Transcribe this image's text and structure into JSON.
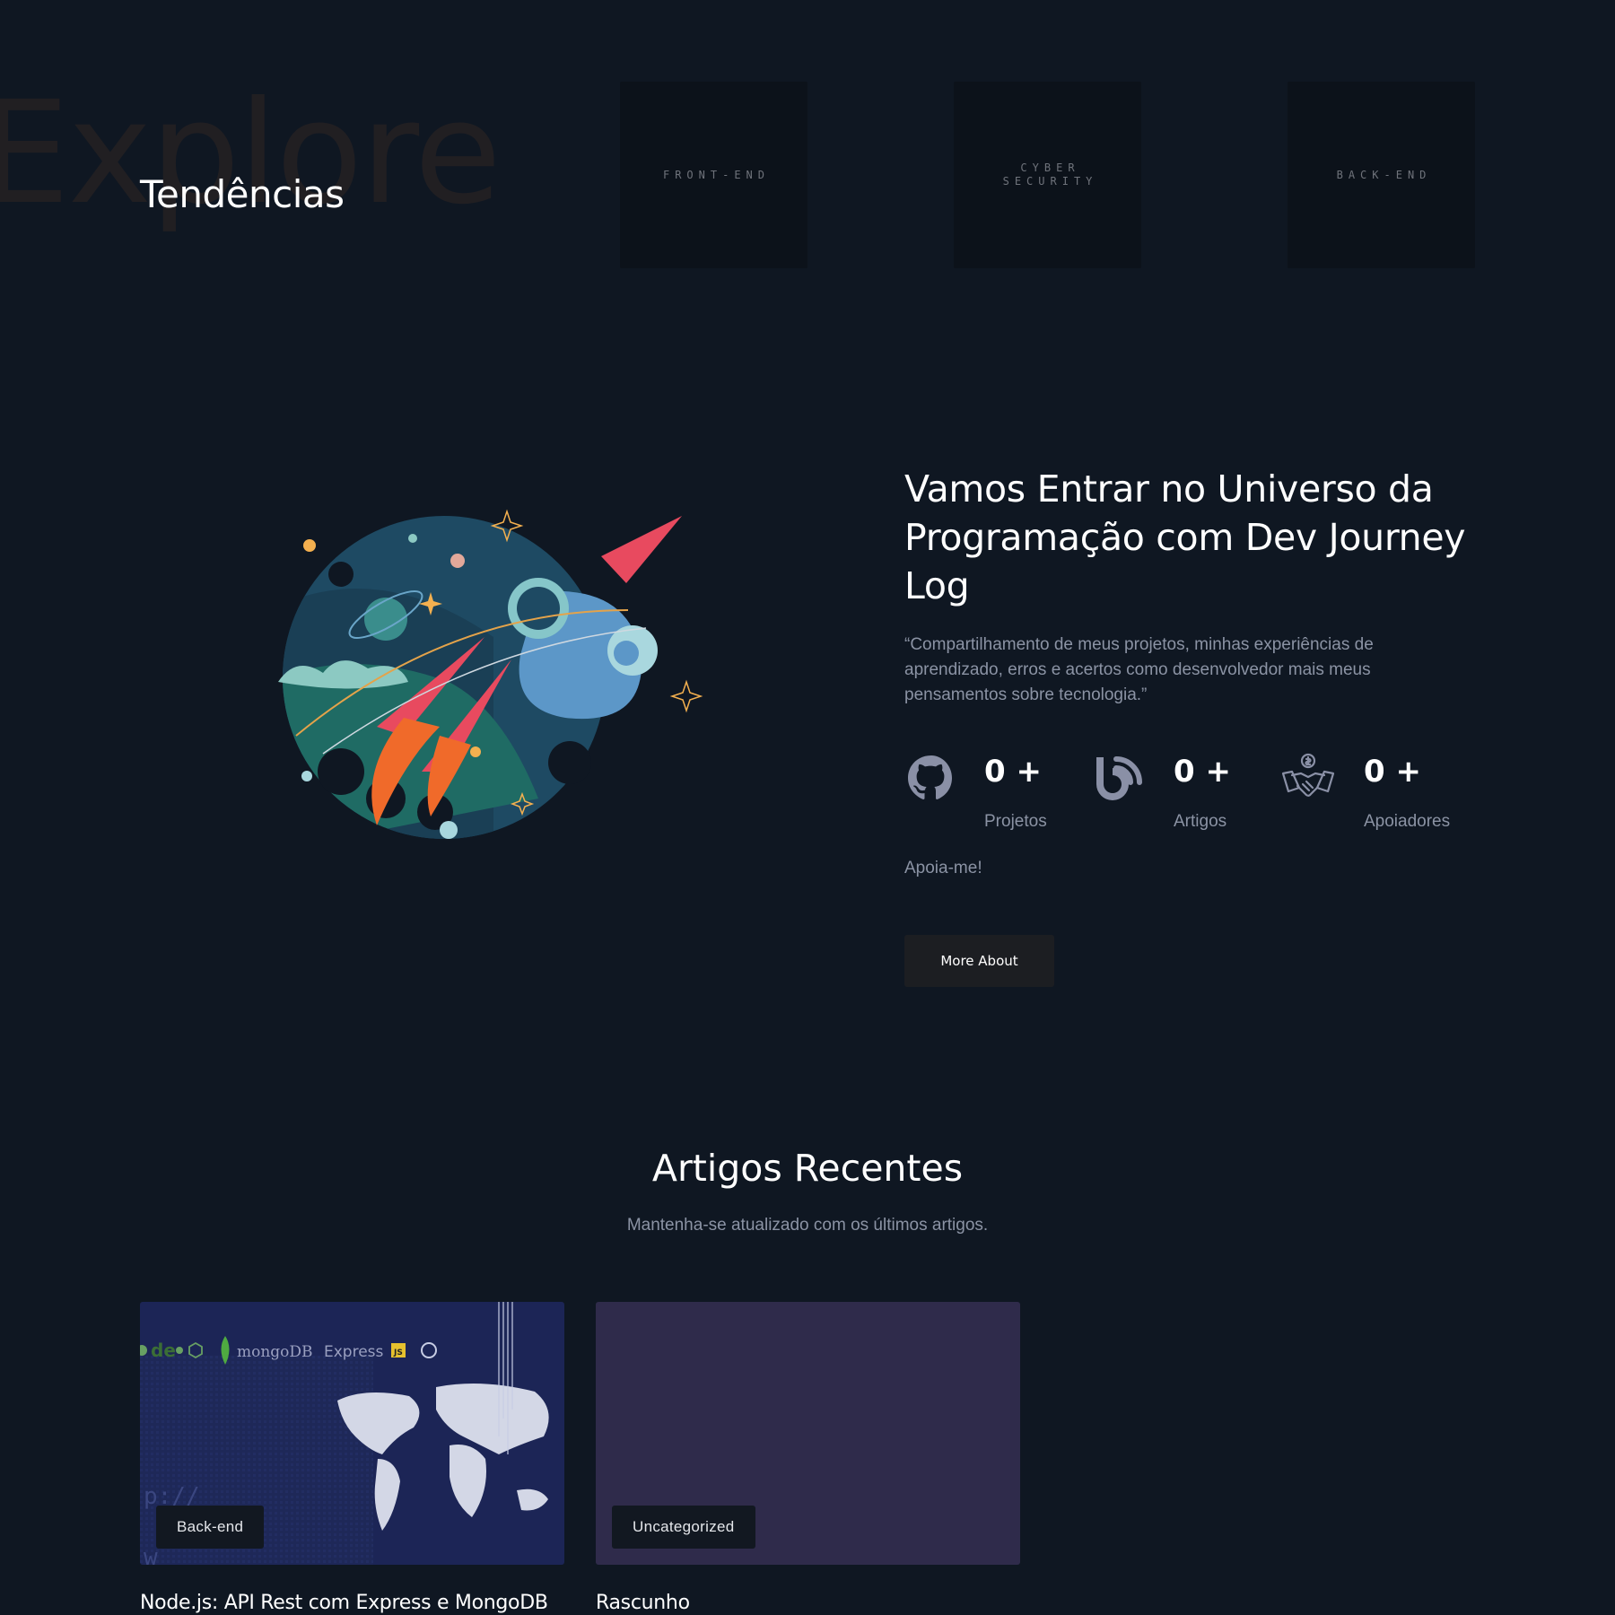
{
  "trends": {
    "background_word": "Explore",
    "title": "Tendências",
    "categories": [
      {
        "label": "FRONT-END"
      },
      {
        "label": "CYBER\nSECURITY"
      },
      {
        "label": "BACK-END"
      }
    ]
  },
  "hero": {
    "title": "Vamos Entrar no Universo da Programação com Dev Journey Log",
    "quote": "“Compartilhamento de meus projetos, minhas experiências de aprendizado, erros e acertos como desenvolvedor mais meus pensamentos sobre tecnologia.”",
    "stats": [
      {
        "icon": "github-icon",
        "value": "0 +",
        "label": "Projetos"
      },
      {
        "icon": "blog-icon",
        "value": "0 +",
        "label": "Artigos"
      },
      {
        "icon": "handshake-icon",
        "value": "0 +",
        "label": "Apoiadores"
      }
    ],
    "support_link": "Apoia-me!",
    "more_button": "More About"
  },
  "recent": {
    "title": "Artigos Recentes",
    "subtitle": "Mantenha-se atualizado com os últimos artigos.",
    "articles": [
      {
        "tag": "Back-end",
        "title": "Node.js: API Rest com Express e MongoDB",
        "image_text": {
          "mongo": "mongoDB",
          "express": "Express",
          "js": "JS",
          "code": "p://",
          "code2": "w"
        }
      },
      {
        "tag": "Uncategorized",
        "title": "Rascunho"
      }
    ]
  },
  "colors": {
    "background": "#0f1722",
    "tile": "#0c121a",
    "muted_text": "#8b93a4",
    "button": "#1c1e22",
    "draft_card": "#2f2b4b"
  }
}
